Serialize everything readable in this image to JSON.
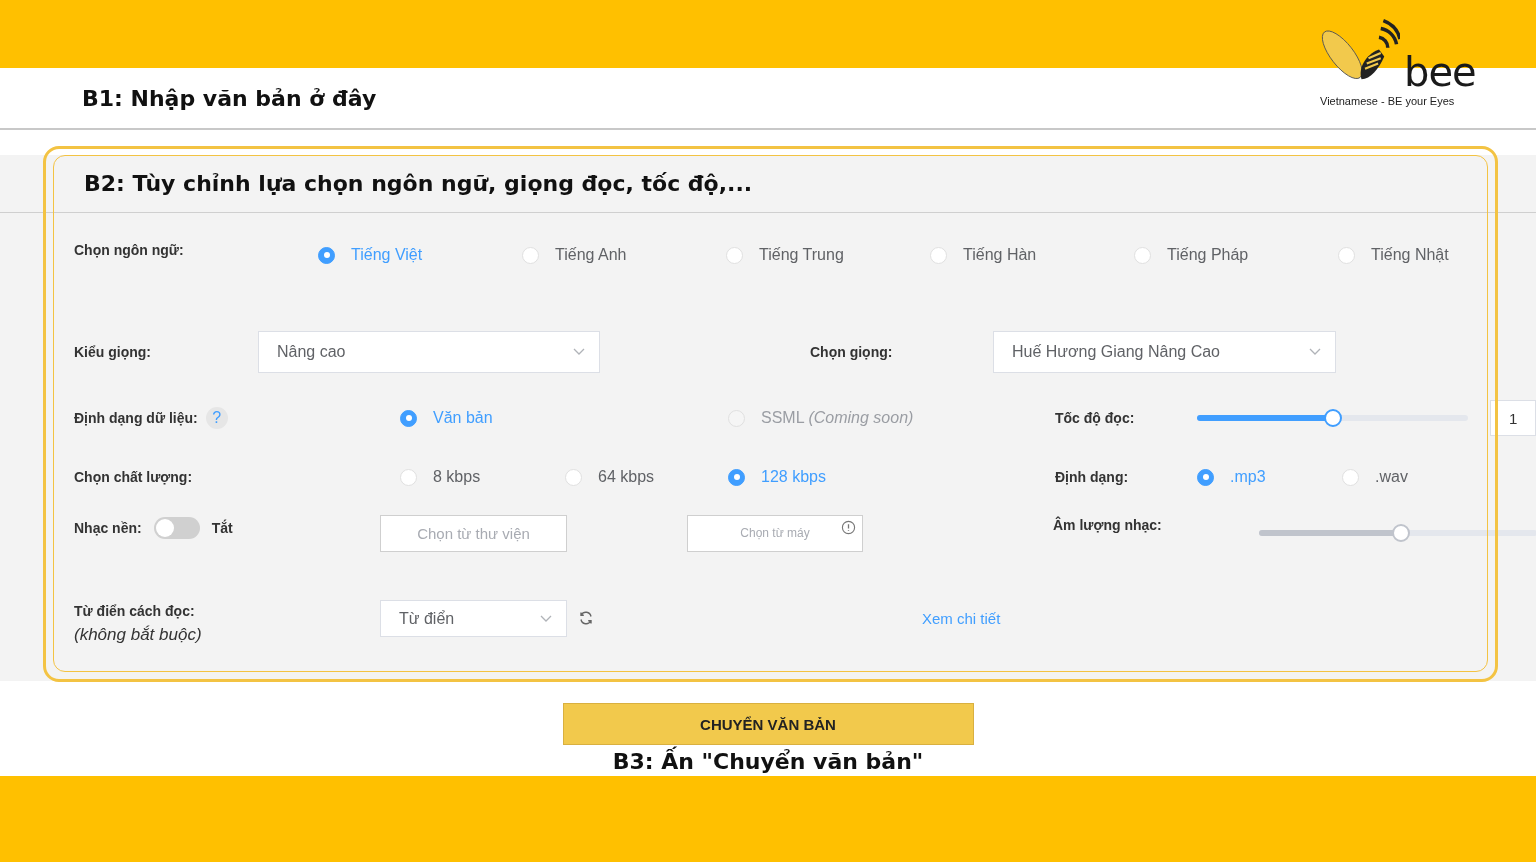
{
  "header_step": "B1: Nhập văn bản ở đây",
  "logo": {
    "brand": "bee",
    "tagline": "Vietnamese - BE your Eyes"
  },
  "settings_step": "B2: Tùy chỉnh lựa chọn ngôn ngữ, giọng đọc, tốc độ,...",
  "language": {
    "label": "Chọn ngôn ngữ:",
    "options": [
      {
        "label": "Tiếng Việt",
        "selected": true
      },
      {
        "label": "Tiếng Anh",
        "selected": false
      },
      {
        "label": "Tiếng Trung",
        "selected": false
      },
      {
        "label": "Tiếng Hàn",
        "selected": false
      },
      {
        "label": "Tiếng Pháp",
        "selected": false
      },
      {
        "label": "Tiếng Nhật",
        "selected": false
      }
    ]
  },
  "voice_type": {
    "label": "Kiểu giọng:",
    "value": "Nâng cao"
  },
  "voice": {
    "label": "Chọn giọng:",
    "value": "Huế Hương Giang Nâng Cao"
  },
  "data_format": {
    "label": "Định dạng dữ liệu:",
    "help": "?",
    "options": [
      {
        "label": "Văn bản",
        "selected": true,
        "disabled": false
      },
      {
        "label": "SSML *(Coming soon)*",
        "selected": false,
        "disabled": true
      }
    ]
  },
  "speed": {
    "label": "Tốc độ đọc:",
    "level": 0.5,
    "value": "1"
  },
  "quality": {
    "label": "Chọn chất lượng:",
    "options": [
      {
        "label": "8 kbps",
        "selected": false
      },
      {
        "label": "64 kbps",
        "selected": false
      },
      {
        "label": "128 kbps",
        "selected": true
      }
    ]
  },
  "file_format": {
    "label": "Định dạng:",
    "options": [
      {
        "label": ".mp3",
        "selected": true
      },
      {
        "label": ".wav",
        "selected": false
      }
    ]
  },
  "background_music": {
    "label": "Nhạc nền:",
    "on": false,
    "state_text": "Tắt",
    "library_button": "Chọn từ thư viện",
    "device_button": "Chọn từ máy"
  },
  "music_volume": {
    "label": "Âm lượng nhạc:",
    "level": 0.51
  },
  "dictionary": {
    "label": "Từ điển cách đọc:",
    "note": "(không bắt buộc)",
    "value": "Từ điển",
    "link": "Xem chi tiết"
  },
  "convert_button": "CHUYỂN VĂN BẢN",
  "final_step": "B3: Ấn \"Chuyển văn bản\""
}
